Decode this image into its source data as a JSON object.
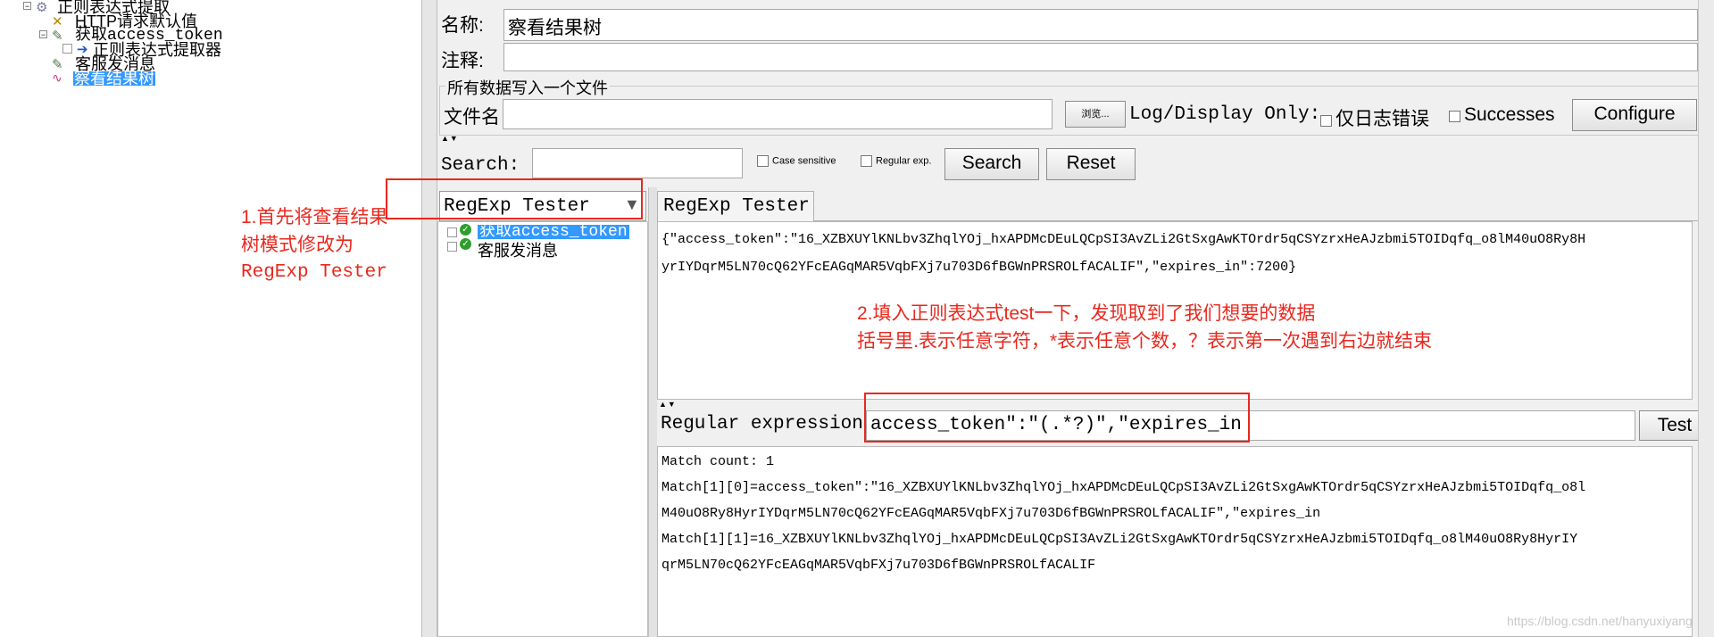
{
  "tree": {
    "items": [
      {
        "label": "正则表达式提取",
        "icon": "gear-icon"
      },
      {
        "label": "HTTP请求默认值",
        "icon": "wrench-icon"
      },
      {
        "label": "获取access_token",
        "icon": "pen-icon"
      },
      {
        "label": "正则表达式提取器",
        "icon": "arrow-icon"
      },
      {
        "label": "客服发消息",
        "icon": "pen-icon"
      },
      {
        "label": "察看结果树",
        "icon": "chart-icon"
      }
    ]
  },
  "form": {
    "name_label": "名称:",
    "name_value": "察看结果树",
    "comment_label": "注释:",
    "file_group_title": "所有数据写入一个文件",
    "filename_label": "文件名",
    "browse_label": "浏览...",
    "log_display_label": "Log/Display Only:",
    "errors_only_label": "仅日志错误",
    "successes_label": "Successes",
    "configure_label": "Configure"
  },
  "search": {
    "label": "Search:",
    "case_sensitive_label": "Case sensitive",
    "regular_exp_label": "Regular exp.",
    "search_button": "Search",
    "reset_button": "Reset"
  },
  "renderer": {
    "selected": "RegExp Tester",
    "tab_label": "RegExp Tester"
  },
  "results": [
    {
      "label": "获取access_token",
      "selected": true
    },
    {
      "label": "客服发消息",
      "selected": false
    }
  ],
  "response": {
    "line1": "{\"access_token\":\"16_XZBXUYlKNLbv3ZhqlYOj_hxAPDMcDEuLQCpSI3AvZLi2GtSxgAwKTOrdr5qCSYzrxHeAJzbmi5TOIDqfq_o8lM40uO8Ry8H",
    "line2": "yrIYDqrM5LN70cQ62YFcEAGqMAR5VqbFXj7u703D6fBGWnPRSROLfACALIF\",\"expires_in\":7200}"
  },
  "regex": {
    "label": "Regular expression:",
    "value": "access_token\":\"(.*?)\",\"expires_in",
    "test_button": "Test"
  },
  "match": {
    "lines": [
      "Match count: 1",
      "Match[1][0]=access_token\":\"16_XZBXUYlKNLbv3ZhqlYOj_hxAPDMcDEuLQCpSI3AvZLi2GtSxgAwKTOrdr5qCSYzrxHeAJzbmi5TOIDqfq_o8l",
      "M40uO8Ry8HyrIYDqrM5LN70cQ62YFcEAGqMAR5VqbFXj7u703D6fBGWnPRSROLfACALIF\",\"expires_in",
      "Match[1][1]=16_XZBXUYlKNLbv3ZhqlYOj_hxAPDMcDEuLQCpSI3AvZLi2GtSxgAwKTOrdr5qCSYzrxHeAJzbmi5TOIDqfq_o8lM40uO8Ry8HyrIY",
      "qrM5LN70cQ62YFcEAGqMAR5VqbFXj7u703D6fBGWnPRSROLfACALIF"
    ]
  },
  "annotations": {
    "note1": [
      "1.首先将查看结果",
      "树模式修改为",
      "RegExp Tester"
    ],
    "note2": [
      "2.填入正则表达式test一下，发现取到了我们想要的数据",
      "括号里.表示任意字符，*表示任意个数，？表示第一次遇到右边就结束"
    ]
  },
  "watermark": "https://blog.csdn.net/hanyuxiyang",
  "colors": {
    "annotation_red": "#e8281e",
    "selection_blue": "#3399ff",
    "panel_gray": "#f0f0f0"
  }
}
